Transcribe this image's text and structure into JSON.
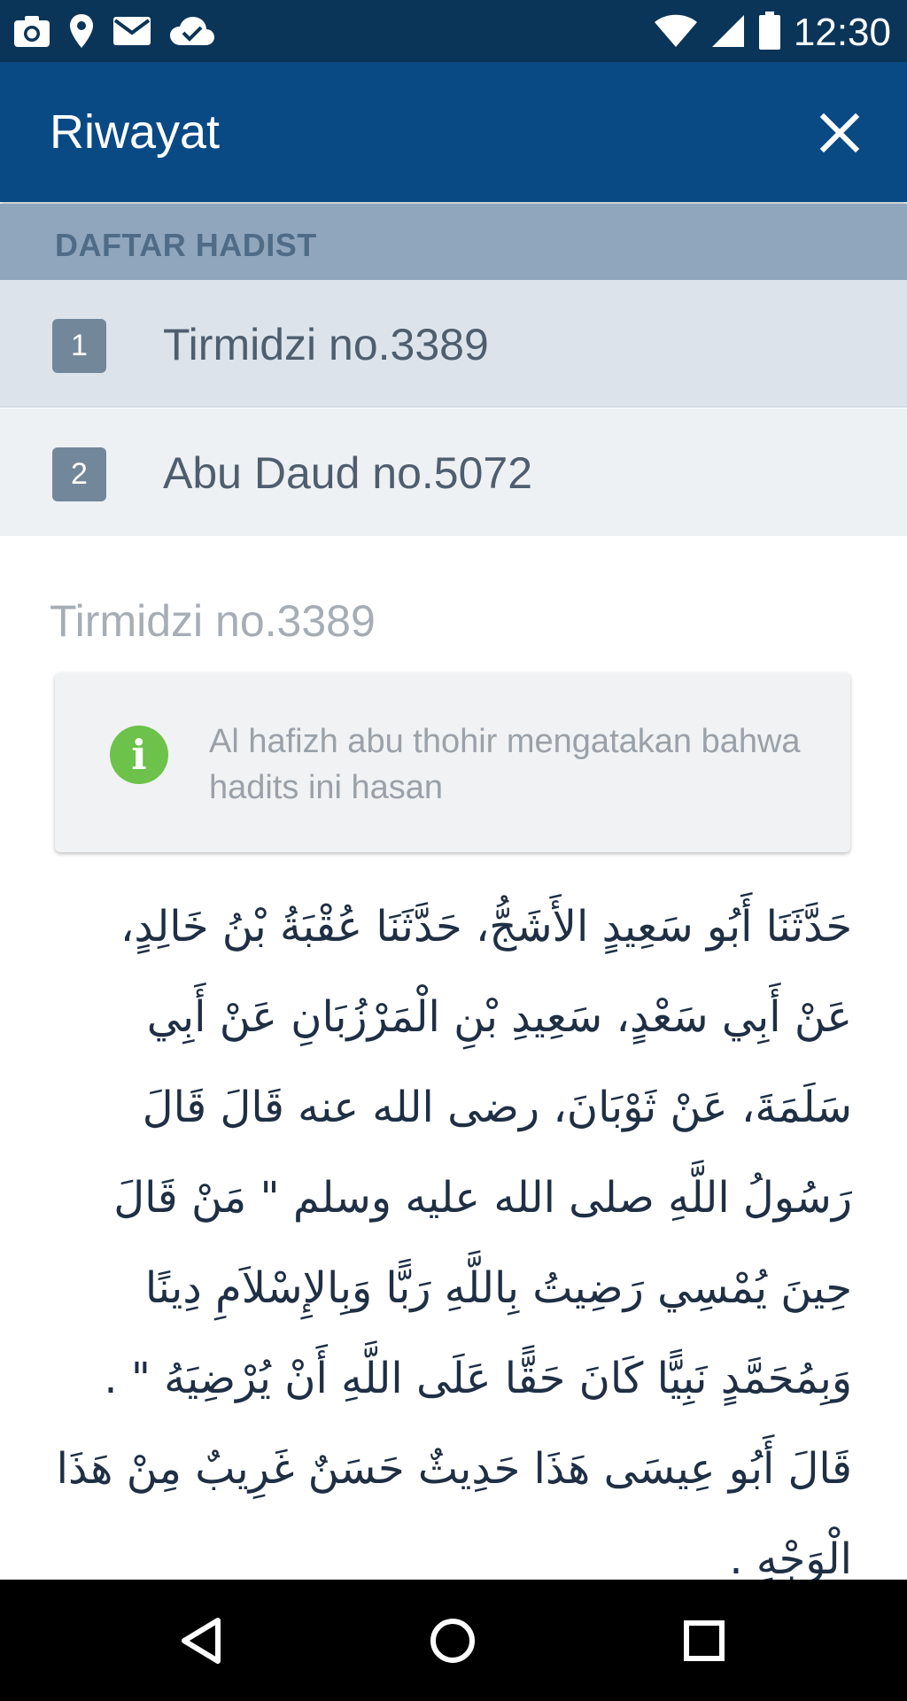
{
  "status_bar": {
    "time": "12:30",
    "left_icons": [
      "camera-icon",
      "location-pin-icon",
      "mail-icon",
      "cloud-done-icon"
    ],
    "right_icons": [
      "wifi-icon",
      "cell-signal-icon",
      "battery-icon"
    ]
  },
  "app_bar": {
    "title": "Riwayat",
    "close_icon": "close-icon"
  },
  "section": {
    "header": "DAFTAR HADIST"
  },
  "hadith_list": [
    {
      "number": "1",
      "label": "Tirmidzi no.3389",
      "selected": true
    },
    {
      "number": "2",
      "label": "Abu Daud no.5072",
      "selected": false
    }
  ],
  "detail": {
    "title": "Tirmidzi no.3389",
    "info_icon": "info-icon",
    "info_text": "Al hafizh abu thohir mengatakan bahwa hadits ini hasan",
    "arabic_text": "حَدَّثَنَا أَبُو سَعِيدٍ الأَشَجُّ، حَدَّثَنَا عُقْبَةُ بْنُ خَالِدٍ، عَنْ أَبِي سَعْدٍ، سَعِيدِ بْنِ الْمَرْزُبَانِ عَنْ أَبِي سَلَمَةَ، عَنْ ثَوْبَانَ، رضى الله عنه قَالَ قَالَ رَسُولُ اللَّهِ صلى الله عليه وسلم \" مَنْ قَالَ حِينَ يُمْسِي رَضِيتُ بِاللَّهِ رَبًّا وَبِالإِسْلاَمِ دِينًا وَبِمُحَمَّدٍ نَبِيًّا كَانَ حَقًّا عَلَى اللَّهِ أَنْ يُرْضِيَهُ \" . قَالَ أَبُو عِيسَى هَذَا حَدِيثٌ حَسَنٌ غَرِيبٌ مِنْ هَذَا الْوَجْهِ ."
  },
  "nav_bar": {
    "buttons": [
      "back-triangle-icon",
      "home-circle-icon",
      "recents-square-icon"
    ]
  },
  "colors": {
    "status_bar": "#0b3558",
    "app_bar": "#0a4a84",
    "section_header": "#8fa6bd",
    "selected_item": "#dce3ea",
    "item": "#eef1f4",
    "badge": "#73879a",
    "info_icon": "#6cc24a",
    "nav_bar": "#000000"
  }
}
